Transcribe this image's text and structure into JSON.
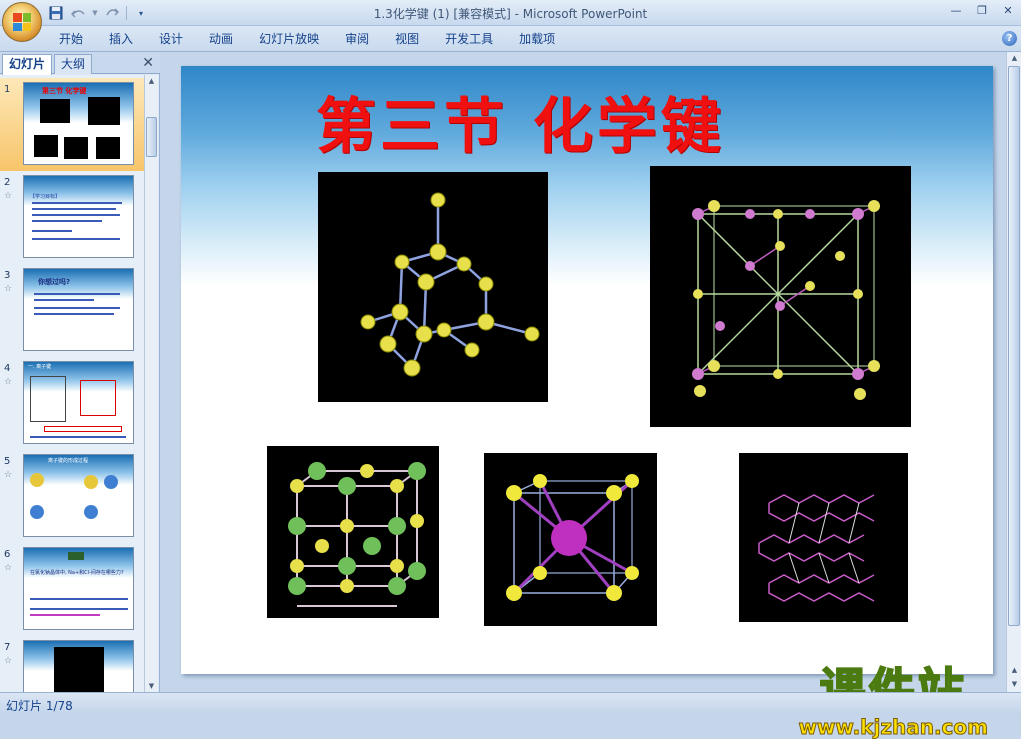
{
  "window": {
    "title": "1.3化学键 (1) [兼容模式] - Microsoft PowerPoint"
  },
  "quick_access": {
    "icons": [
      "save-icon",
      "undo-icon",
      "redo-icon",
      "customize-icon"
    ]
  },
  "ribbon": {
    "tabs": [
      "开始",
      "插入",
      "设计",
      "动画",
      "幻灯片放映",
      "审阅",
      "视图",
      "开发工具",
      "加载项"
    ]
  },
  "panel": {
    "tab_slides": "幻灯片",
    "tab_outline": "大纲",
    "close": "✕"
  },
  "thumbnails": [
    {
      "num": "1",
      "title": "第三节  化学键"
    },
    {
      "num": "2",
      "text": "【学习目标】"
    },
    {
      "num": "3",
      "text": "你想过吗?"
    },
    {
      "num": "4",
      "text": "一. 离子键"
    },
    {
      "num": "5",
      "text": "离子键的形成过程"
    },
    {
      "num": "6",
      "text": "在氯化钠晶体中, Na+和Cl-间存在哪些力?"
    },
    {
      "num": "7",
      "text": ""
    }
  ],
  "slide": {
    "title": "第三节  化学键"
  },
  "status": {
    "slide_counter": "幻灯片 1/78"
  },
  "watermark": {
    "text": "课件站",
    "url": "www.kjzhan.com"
  },
  "colors": {
    "title_red": "#f01010",
    "ribbon_text": "#15428b",
    "selected_thumb": "#f7c56a"
  }
}
